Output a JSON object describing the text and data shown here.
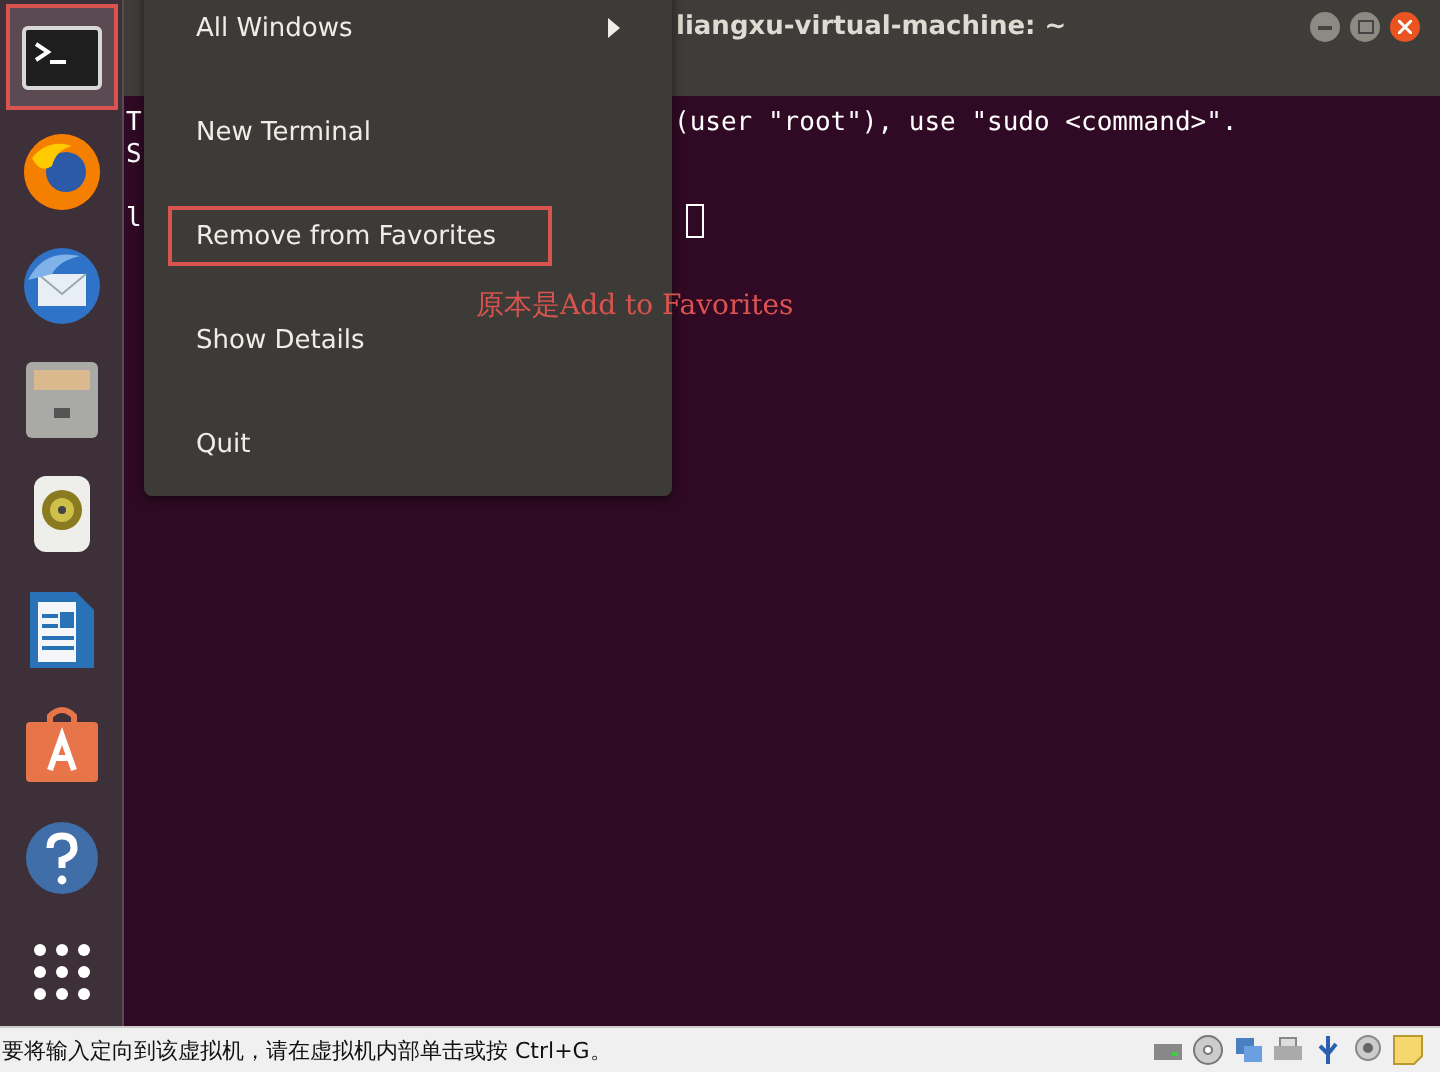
{
  "dock": {
    "items": [
      {
        "kind": "terminal",
        "selected": true
      },
      {
        "kind": "firefox",
        "selected": false
      },
      {
        "kind": "thunderbird",
        "selected": false
      },
      {
        "kind": "files",
        "selected": false
      },
      {
        "kind": "rhythmbox",
        "selected": false
      },
      {
        "kind": "writer",
        "selected": false
      },
      {
        "kind": "software",
        "selected": false
      },
      {
        "kind": "help",
        "selected": false
      },
      {
        "kind": "apps",
        "selected": false
      }
    ]
  },
  "terminal": {
    "title": "liangxu-virtual-machine: ~",
    "lines": [
      {
        "left": "T",
        "right": "(user \"root\"), use \"sudo <command>\".",
        "cursor": false
      },
      {
        "left": "S",
        "cursor": false
      },
      {
        "left": "l",
        "cursor": true
      }
    ]
  },
  "context_menu": {
    "items": [
      {
        "label": "All Windows",
        "submenu": true,
        "highlighted": false
      },
      {
        "label": "New Terminal",
        "submenu": false,
        "highlighted": false
      },
      {
        "label": "Remove from Favorites",
        "submenu": false,
        "highlighted": true
      },
      {
        "label": "Show Details",
        "submenu": false,
        "highlighted": false
      },
      {
        "label": "Quit",
        "submenu": false,
        "highlighted": false
      }
    ]
  },
  "annotation": "原本是Add to Favorites",
  "status_bar": {
    "message": "要将输入定向到该虚拟机，请在虚拟机内部单击或按 Ctrl+G。"
  }
}
